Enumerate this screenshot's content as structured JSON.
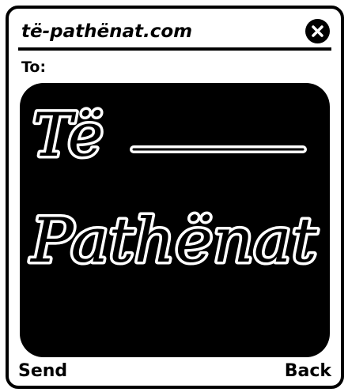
{
  "header": {
    "site_title": "të-pathënat.com",
    "close_icon": "close-circle-icon"
  },
  "recipient": {
    "label": "To:"
  },
  "message": {
    "line1": "Të",
    "line2": "Pathënat",
    "text_color": "#ffffff",
    "background_color": "#000000"
  },
  "footer": {
    "send_label": "Send",
    "back_label": "Back"
  }
}
